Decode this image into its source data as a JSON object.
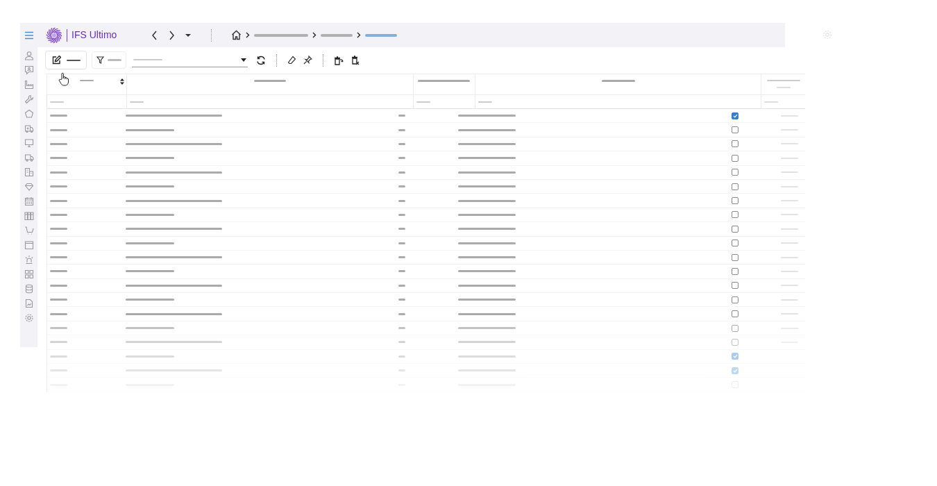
{
  "app": {
    "logo_text": "IFS Ultimo"
  },
  "breadcrumb": [
    {
      "selected": false
    },
    {
      "selected": false
    },
    {
      "selected": true
    }
  ],
  "rows": [
    {
      "checked": true
    },
    {
      "checked": false
    },
    {
      "checked": false
    },
    {
      "checked": false
    },
    {
      "checked": false
    },
    {
      "checked": false
    },
    {
      "checked": false
    },
    {
      "checked": false
    },
    {
      "checked": false
    },
    {
      "checked": false
    },
    {
      "checked": false
    },
    {
      "checked": false
    },
    {
      "checked": false
    },
    {
      "checked": false
    },
    {
      "checked": false
    },
    {
      "checked": false
    },
    {
      "checked": false
    },
    {
      "checked": true
    },
    {
      "checked": true
    },
    {
      "checked": false
    }
  ]
}
